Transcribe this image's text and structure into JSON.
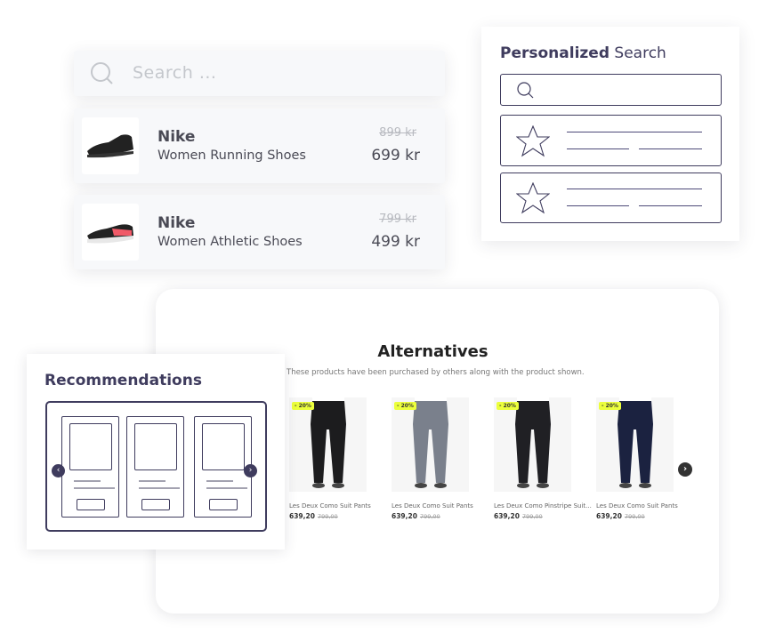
{
  "search": {
    "placeholder": "Search ..."
  },
  "results": [
    {
      "brand": "Nike",
      "name": "Women Running Shoes",
      "old_price": "899 kr",
      "price": "699 kr",
      "shoe_accent": "#222222"
    },
    {
      "brand": "Nike",
      "name": "Women Athletic Shoes",
      "old_price": "799 kr",
      "price": "499 kr",
      "shoe_accent": "#f05a68"
    }
  ],
  "personalized": {
    "title_bold": "Personalized",
    "title_rest": "Search"
  },
  "alternatives": {
    "title": "Alternatives",
    "subtitle": "These products have been purchased by others along with the product shown.",
    "products": [
      {
        "badge": "- 20%",
        "name": "Les Deux Como Suit Pants",
        "price": "639,20",
        "old_price": "799,00",
        "color": "#1c1c1e"
      },
      {
        "badge": "- 20%",
        "name": "Les Deux Como Suit Pants",
        "price": "639,20",
        "old_price": "799,00",
        "color": "#7a808c"
      },
      {
        "badge": "- 20%",
        "name": "Les Deux Como Pinstripe Suit...",
        "price": "639,20",
        "old_price": "799,00",
        "color": "#202024"
      },
      {
        "badge": "- 20%",
        "name": "Les Deux Como Suit Pants",
        "price": "639,20",
        "old_price": "799,00",
        "color": "#1b2240"
      }
    ]
  },
  "recommendations": {
    "title": "Recommendations"
  },
  "colors": {
    "accent": "#3f3c5e",
    "badge": "#ecff3c"
  }
}
